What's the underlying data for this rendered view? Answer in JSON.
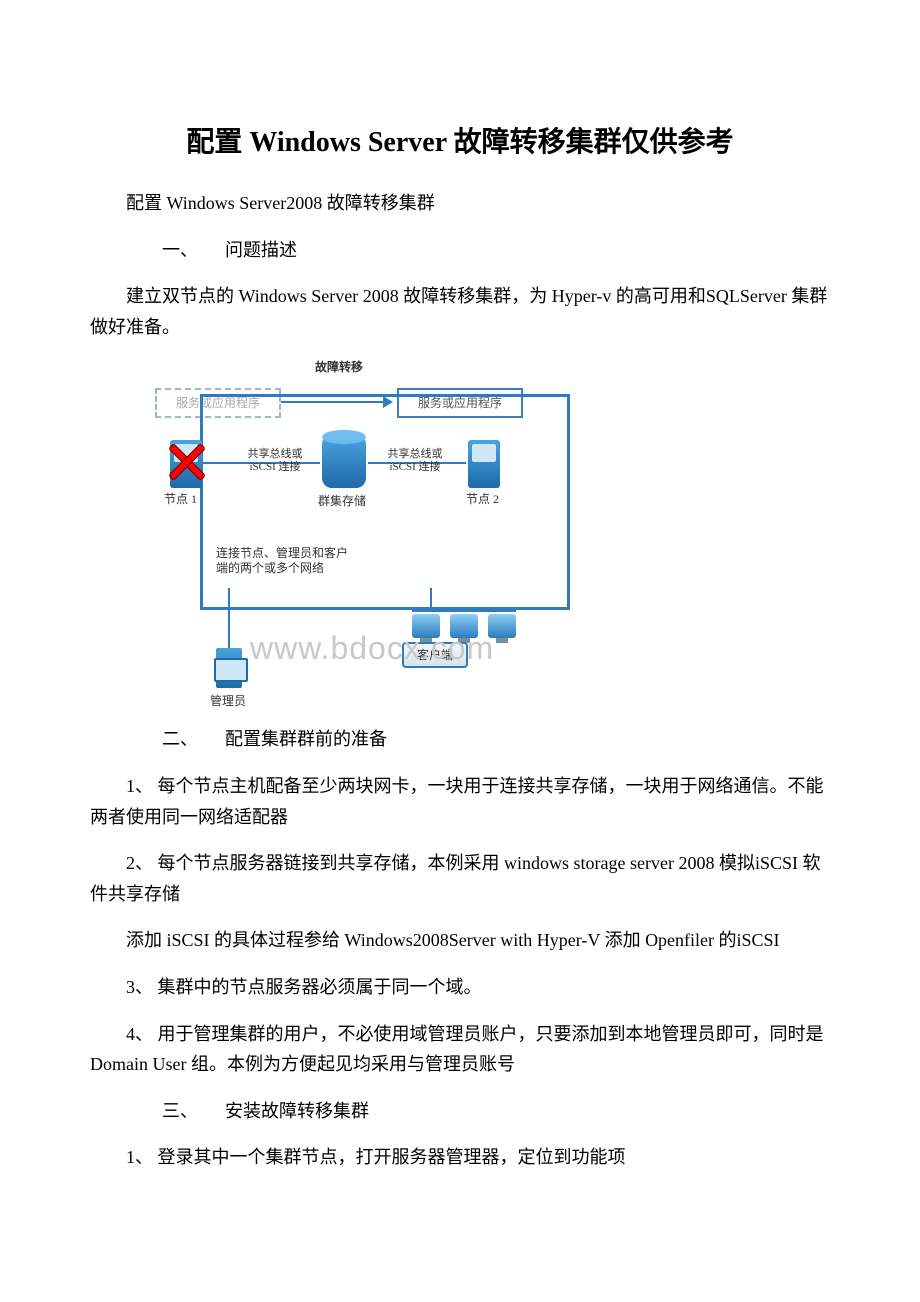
{
  "title": "配置 Windows Server 故障转移集群仅供参考",
  "p1": "配置 Windows Server2008 故障转移集群",
  "sec1_num": "一、",
  "sec1_label": "问题描述",
  "p2": "建立双节点的 Windows Server 2008 故障转移集群，为 Hyper-v 的高可用和SQLServer 集群做好准备。",
  "diagram": {
    "failover": "故障转移",
    "svc_left": "服务或应用程序",
    "svc_right": "服务或应用程序",
    "node1": "节点 1",
    "node2": "节点 2",
    "conn1a": "共享总线或",
    "conn1b": "iSCSI 连接",
    "conn2a": "共享总线或",
    "conn2b": "iSCSI 连接",
    "storage": "群集存储",
    "netdesc": "连接节点、管理员和客户端的两个或多个网络",
    "clients": "客户端",
    "admin": "管理员",
    "watermark": "www.bdocx.com"
  },
  "sec2_num": "二、",
  "sec2_label": "配置集群群前的准备",
  "li1": "1、  每个节点主机配备至少两块网卡，一块用于连接共享存储，一块用于网络通信。不能两者使用同一网络适配器",
  "li2": "2、  每个节点服务器链接到共享存储，本例采用 windows storage server 2008 模拟iSCSI 软件共享存储",
  "li2b": "添加 iSCSI 的具体过程参给 Windows2008Server with Hyper-V 添加 Openfiler 的iSCSI",
  "li3": "3、  集群中的节点服务器必须属于同一个域。",
  "li4": "4、  用于管理集群的用户，不必使用域管理员账户，只要添加到本地管理员即可，同时是 Domain User 组。本例为方便起见均采用与管理员账号",
  "sec3_num": "三、",
  "sec3_label": "安装故障转移集群",
  "li5": "1、  登录其中一个集群节点，打开服务器管理器，定位到功能项"
}
